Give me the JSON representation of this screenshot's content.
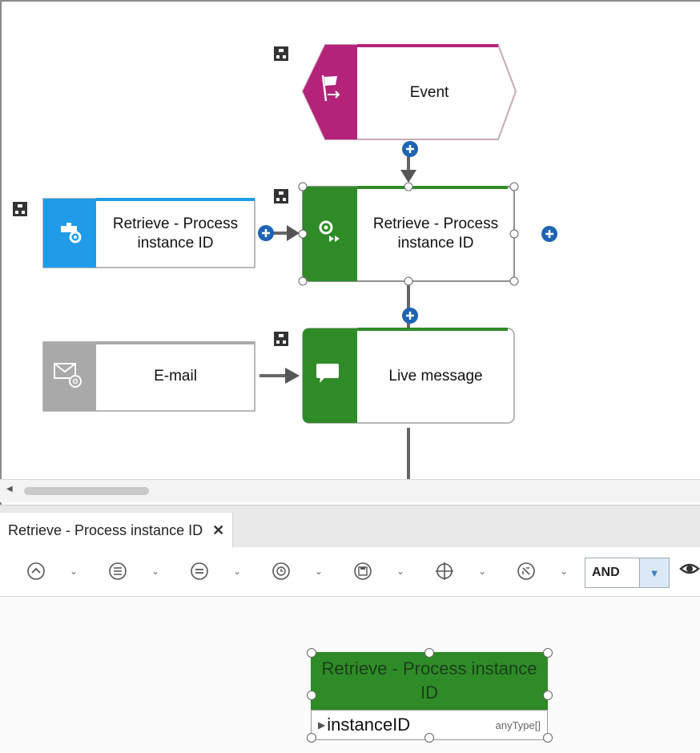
{
  "diagram": {
    "event_node": {
      "label": "Event"
    },
    "service_node": {
      "label": "Retrieve - Process instance ID"
    },
    "function_node": {
      "label": "Retrieve - Process instance ID"
    },
    "email_node": {
      "label": "E-mail"
    },
    "live_message_node": {
      "label": "Live message"
    }
  },
  "panel": {
    "tab_label": "Retrieve - Process instance ID",
    "tab_close": "✕",
    "toolbar": {
      "icons": [
        "chevron-up-circle-icon",
        "list-circle-icon",
        "equals-circle-icon",
        "clock-circle-icon",
        "save-circle-icon",
        "plus-crosshair-icon",
        "move-circle-icon"
      ],
      "logic_select": "AND",
      "eye_icon": "visibility-icon"
    },
    "bottom_node": {
      "title": "Retrieve - Process instance ID",
      "field_name": "instanceID",
      "field_type": "anyType[]"
    }
  },
  "colors": {
    "event_magenta": "#b4237a",
    "function_green": "#2e8b27",
    "service_blue": "#1f9be8",
    "email_gray": "#a9a9a9",
    "connector_blue": "#1e64b4"
  }
}
